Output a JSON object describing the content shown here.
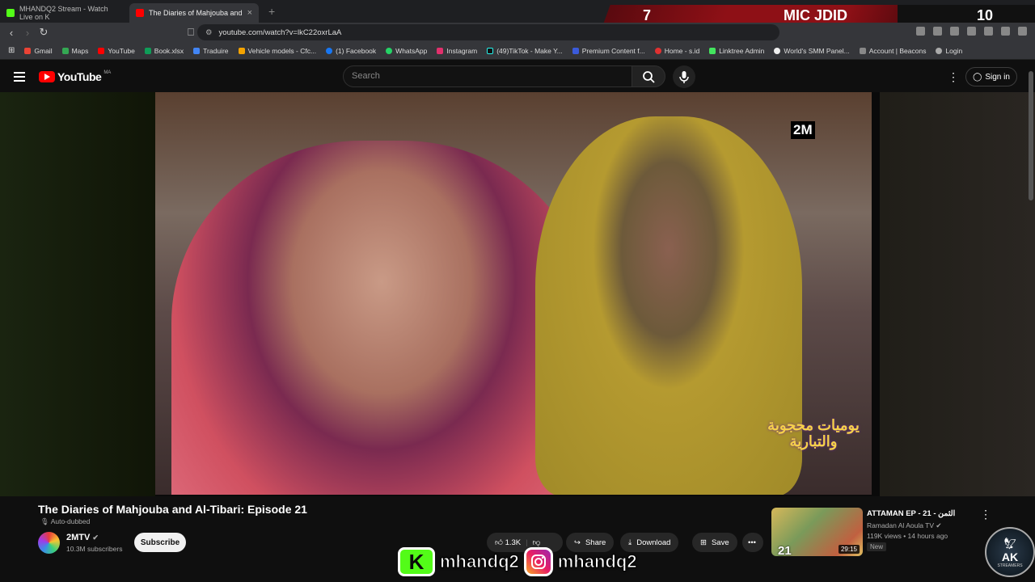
{
  "browser": {
    "tabs": [
      {
        "label": "MHANDQ2 Stream - Watch Live on K",
        "active": false
      },
      {
        "label": "The Diaries of Mahjouba and",
        "active": true
      }
    ],
    "url": "youtube.com/watch?v=lkC22oxrLaA",
    "bookmarks": [
      "Gmail",
      "Maps",
      "YouTube",
      "Book.xlsx",
      "Traduire",
      "Vehicle models - Cfc...",
      "(1) Facebook",
      "WhatsApp",
      "Instagram",
      "(49)TikTok - Make Y...",
      "Premium Content f...",
      "Home - s.id",
      "Linktree Admin",
      "World's SMM Panel...",
      "Account | Beacons",
      "Login"
    ]
  },
  "stream_overlay": {
    "left_score": "7",
    "title": "MIC JDID",
    "right_score": "10"
  },
  "youtube": {
    "logo": "YouTube",
    "region": "MA",
    "search_placeholder": "Search",
    "sign_in": "Sign in"
  },
  "video": {
    "channel_logo": "2M",
    "show_logo": "يوميات محجوبة والتبارية",
    "title": "The Diaries of Mahjouba and Al-Tibari: Episode 21",
    "dub_label": "Auto-dubbed",
    "channel": "2MTV",
    "subscribers": "10.3M subscribers",
    "subscribe": "Subscribe",
    "likes": "1.3K",
    "share": "Share",
    "download": "Download",
    "save": "Save"
  },
  "recommended": {
    "title": "ATTAMAN EP - 21 - الثمن",
    "channel": "Ramadan Al Aoula TV",
    "meta": "119K views • 14 hours ago",
    "badge": "New",
    "duration": "29:15",
    "episode": "21"
  },
  "watermark": {
    "kick_handle": "mhandq2",
    "ig_handle": "mhandq2",
    "kick_letter": "K"
  },
  "ak_badge": {
    "letters": "AK",
    "sub": "STREAMERS"
  },
  "colors": {
    "yt_red": "#ff0000",
    "overlay_red": "#8e1016",
    "kick_green": "#53fc18"
  }
}
